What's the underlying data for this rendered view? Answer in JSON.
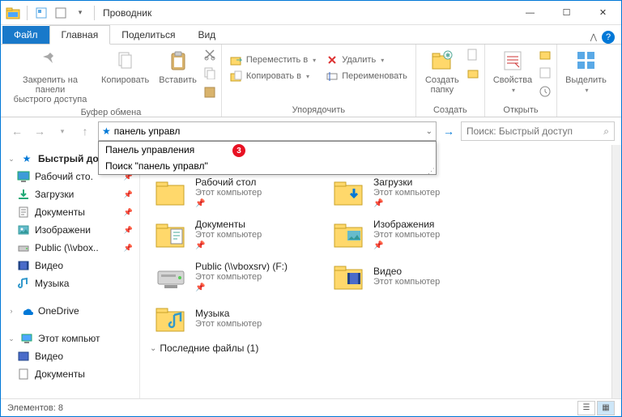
{
  "window": {
    "title": "Проводник"
  },
  "tabs": {
    "file": "Файл",
    "home": "Главная",
    "share": "Поделиться",
    "view": "Вид"
  },
  "ribbon": {
    "clipboard": {
      "pin": "Закрепить на панели\nбыстрого доступа",
      "copy": "Копировать",
      "paste": "Вставить",
      "label": "Буфер обмена"
    },
    "organize": {
      "move": "Переместить в",
      "copyto": "Копировать в",
      "delete": "Удалить",
      "rename": "Переименовать",
      "label": "Упорядочить"
    },
    "new": {
      "folder": "Создать\nпапку",
      "label": "Создать"
    },
    "open": {
      "props": "Свойства",
      "label": "Открыть"
    },
    "select": {
      "btn": "Выделить",
      "label": ""
    }
  },
  "address": {
    "value": "панель управл",
    "suggest1": "Панель управления",
    "suggest2": "Поиск \"панель управл\"",
    "badge": "3"
  },
  "search": {
    "placeholder": "Поиск: Быстрый доступ"
  },
  "sidebar": {
    "quick": "Быстрый дост",
    "items": [
      {
        "label": "Рабочий сто.",
        "icon": "desktop"
      },
      {
        "label": "Загрузки",
        "icon": "downloads"
      },
      {
        "label": "Документы",
        "icon": "documents"
      },
      {
        "label": "Изображени",
        "icon": "pictures"
      },
      {
        "label": "Public (\\\\vbox..",
        "icon": "network"
      },
      {
        "label": "Видео",
        "icon": "video"
      },
      {
        "label": "Музыка",
        "icon": "music"
      }
    ],
    "onedrive": "OneDrive",
    "thispc": "Этот компьют",
    "pc_items": [
      {
        "label": "Видео",
        "icon": "video"
      },
      {
        "label": "Документы",
        "icon": "documents"
      }
    ]
  },
  "content": {
    "sub": "Этот компьютер",
    "items": [
      {
        "name": "Рабочий стол",
        "icon": "folder"
      },
      {
        "name": "Загрузки",
        "icon": "downloads"
      },
      {
        "name": "Документы",
        "icon": "documents"
      },
      {
        "name": "Изображения",
        "icon": "pictures"
      },
      {
        "name": "Public (\\\\vboxsrv) (F:)",
        "icon": "drive"
      },
      {
        "name": "Видео",
        "icon": "video"
      },
      {
        "name": "Музыка",
        "icon": "music"
      }
    ],
    "recent": "Последние файлы (1)"
  },
  "status": {
    "count": "Элементов: 8"
  }
}
